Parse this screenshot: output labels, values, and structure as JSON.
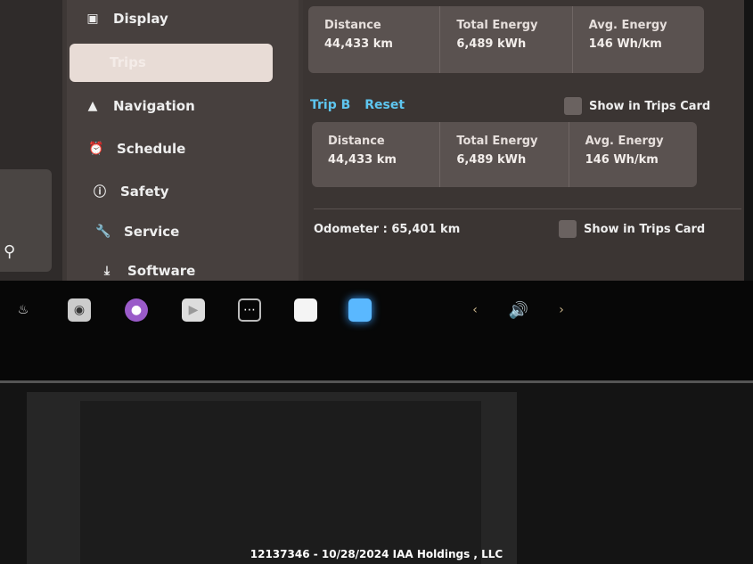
{
  "sidebar": {
    "items": [
      {
        "label": "Display",
        "icon": "display-icon"
      },
      {
        "label": "Trips",
        "icon": "trips-icon",
        "selected": true
      },
      {
        "label": "Navigation",
        "icon": "navigation-icon"
      },
      {
        "label": "Schedule",
        "icon": "alarm-clock-icon"
      },
      {
        "label": "Safety",
        "icon": "safety-icon"
      },
      {
        "label": "Service",
        "icon": "wrench-icon"
      },
      {
        "label": "Software",
        "icon": "download-icon"
      }
    ]
  },
  "trip_a": {
    "distance_label": "Distance",
    "distance": "44,433 km",
    "energy_label": "Total Energy",
    "energy": "6,489 kWh",
    "avg_label": "Avg. Energy",
    "avg": "146 Wh/km"
  },
  "trip_b": {
    "title": "Trip B",
    "reset": "Reset",
    "show_label": "Show in Trips Card",
    "distance_label": "Distance",
    "distance": "44,433 km",
    "energy_label": "Total Energy",
    "energy": "6,489 kWh",
    "avg_label": "Avg. Energy",
    "avg": "146 Wh/km"
  },
  "odometer": {
    "label": "Odometer :",
    "value": "65,401 km",
    "show_label": "Show in Trips Card"
  },
  "accent": "#5ec6f0",
  "dock": {
    "icons": [
      "rear-defrost-icon",
      "camera-icon",
      "media-icon",
      "video-icon",
      "more-icon",
      "notes-icon",
      "app-icon",
      "chevron-left-icon",
      "volume-icon",
      "chevron-right-icon"
    ]
  },
  "footer": "12137346 - 10/28/2024 IAA Holdings , LLC"
}
